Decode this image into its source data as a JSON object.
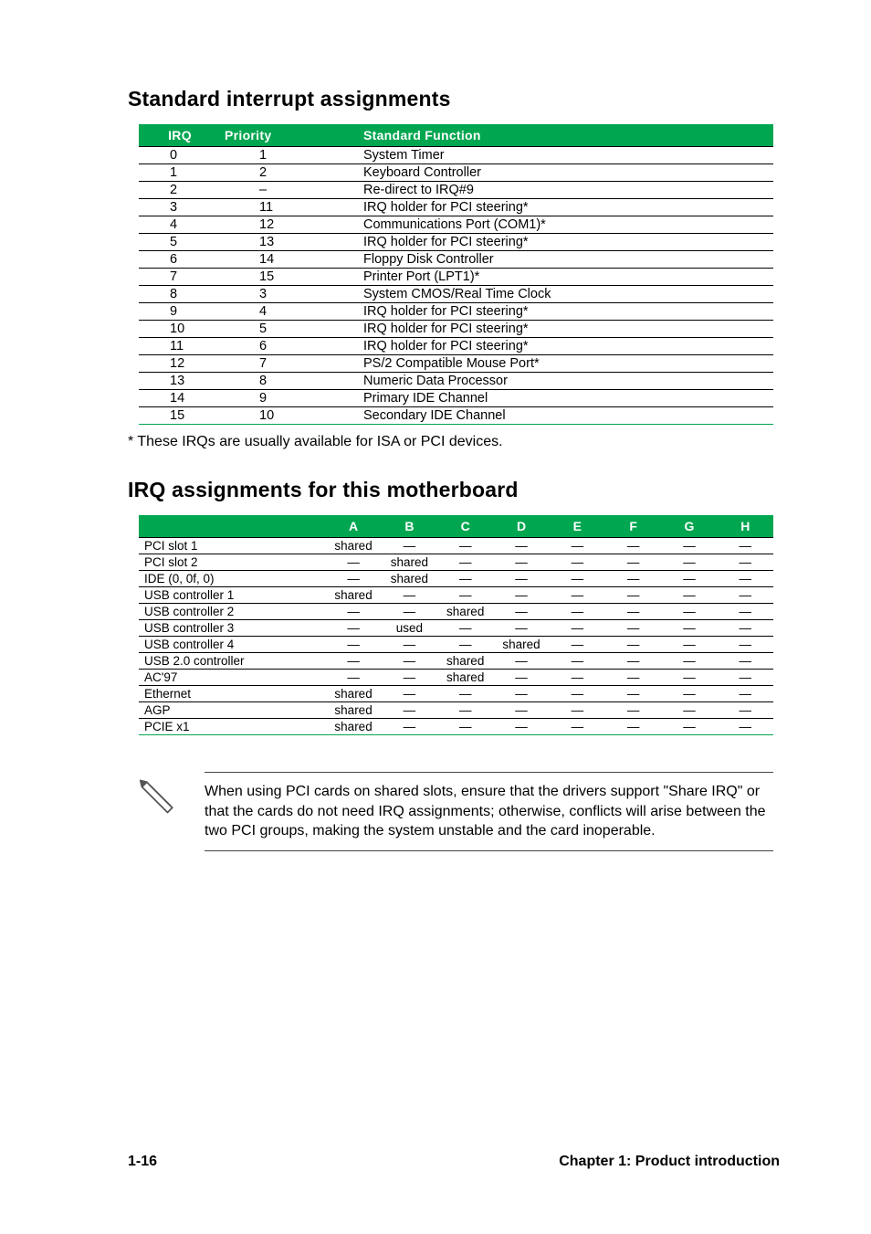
{
  "section1": {
    "title": "Standard interrupt assignments",
    "headers": [
      "IRQ",
      "Priority",
      "Standard Function"
    ],
    "rows": [
      [
        "0",
        "1",
        "System Timer"
      ],
      [
        "1",
        "2",
        "Keyboard Controller"
      ],
      [
        "2",
        "–",
        "Re-direct to IRQ#9"
      ],
      [
        "3",
        "11",
        "IRQ holder for PCI steering*"
      ],
      [
        "4",
        "12",
        "Communications Port (COM1)*"
      ],
      [
        "5",
        "13",
        "IRQ holder for PCI steering*"
      ],
      [
        "6",
        "14",
        "Floppy Disk Controller"
      ],
      [
        "7",
        "15",
        "Printer Port (LPT1)*"
      ],
      [
        "8",
        "3",
        "System CMOS/Real Time Clock"
      ],
      [
        "9",
        "4",
        "IRQ holder for PCI steering*"
      ],
      [
        "10",
        "5",
        "IRQ holder for PCI steering*"
      ],
      [
        "11",
        "6",
        "IRQ holder for PCI steering*"
      ],
      [
        "12",
        "7",
        "PS/2 Compatible Mouse Port*"
      ],
      [
        "13",
        "8",
        "Numeric Data Processor"
      ],
      [
        "14",
        "9",
        "Primary IDE Channel"
      ],
      [
        "15",
        "10",
        "Secondary IDE Channel"
      ]
    ],
    "footnote": "* These IRQs are usually available for ISA or PCI devices."
  },
  "section2": {
    "title": "IRQ assignments for this motherboard",
    "headers": [
      "",
      "A",
      "B",
      "C",
      "D",
      "E",
      "F",
      "G",
      "H"
    ],
    "rows": [
      [
        "PCI slot 1",
        "shared",
        "—",
        "—",
        "—",
        "—",
        "—",
        "—",
        "—"
      ],
      [
        "PCI slot 2",
        "—",
        "shared",
        "—",
        "—",
        "—",
        "—",
        "—",
        "—"
      ],
      [
        "IDE (0, 0f, 0)",
        "—",
        "shared",
        "—",
        "—",
        "—",
        "—",
        "—",
        "—"
      ],
      [
        "USB controller 1",
        "shared",
        "—",
        "—",
        "—",
        "—",
        "—",
        "—",
        "—"
      ],
      [
        "USB controller 2",
        "—",
        "—",
        "shared",
        "—",
        "—",
        "—",
        "—",
        "—"
      ],
      [
        "USB controller 3",
        "—",
        "used",
        "—",
        "—",
        "—",
        "—",
        "—",
        "—"
      ],
      [
        "USB controller 4",
        "—",
        "—",
        "—",
        "shared",
        "—",
        "—",
        "—",
        "—"
      ],
      [
        "USB 2.0 controller",
        "—",
        "—",
        "shared",
        "—",
        "—",
        "—",
        "—",
        "—"
      ],
      [
        "AC'97",
        "—",
        "—",
        "shared",
        "—",
        "—",
        "—",
        "—",
        "—"
      ],
      [
        "Ethernet",
        "shared",
        "—",
        "—",
        "—",
        "—",
        "—",
        "—",
        "—"
      ],
      [
        "AGP",
        "shared",
        "—",
        "—",
        "—",
        "—",
        "—",
        "—",
        "—"
      ],
      [
        "PCIE  x1",
        "shared",
        "—",
        "—",
        "—",
        "—",
        "—",
        "—",
        "—"
      ]
    ]
  },
  "note": "When using PCI cards on shared slots, ensure that the drivers support \"Share IRQ\" or that the cards do not need IRQ assignments; otherwise, conflicts will arise between the two PCI groups, making the system unstable and the card inoperable.",
  "footer": {
    "left": "1-16",
    "right": "Chapter 1: Product introduction"
  }
}
